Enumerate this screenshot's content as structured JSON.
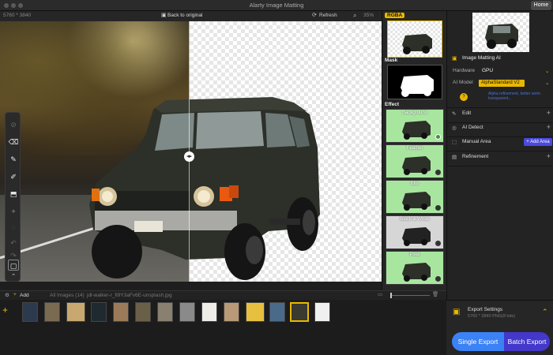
{
  "app": {
    "title": "Alarty Image Matting",
    "home_label": "Home"
  },
  "toolbar": {
    "dimensions": "5760 * 3840",
    "back_label": "Back to original",
    "refresh_label": "Refresh",
    "zoom": "35%"
  },
  "preview_column": {
    "rgba_label": "RGBA",
    "mask_label": "Mask",
    "effect_label": "Effect",
    "effects": [
      {
        "label": "Background",
        "selected": true
      },
      {
        "label": "Feather",
        "selected": false
      },
      {
        "label": "Blur",
        "selected": false
      },
      {
        "label": "Black & White",
        "selected": false
      },
      {
        "label": "Pixel",
        "selected": false
      }
    ]
  },
  "panel": {
    "section_title": "Image Matting AI",
    "hardware_label": "Hardware",
    "hardware_value": "GPU",
    "model_label": "AI Model",
    "model_value": "AlphaStandard  V2",
    "model_hint": "Alpha refinement, better semi-transparent...",
    "edit_label": "Edit",
    "detect_label": "AI Detect",
    "manual_label": "Manual Area",
    "add_area_label": "+ Add Area",
    "refinement_label": "Refinement"
  },
  "strip": {
    "add_label": "Add",
    "all_images_label": "All Images (14)",
    "current_file": "jdl-walker-r_fi9Y3aFv6E-unsplash.jpg",
    "image_count": 14
  },
  "export": {
    "title": "Export Settings",
    "detail": "5760 * 3840  PNG(8 bits)",
    "single_label": "Single Export",
    "batch_label": "Batch Export"
  },
  "colors": {
    "accent": "#e8b800",
    "primary": "#3b82f6",
    "batch": "#4338ca",
    "effect_bg": "#a8e6a0"
  },
  "icons": [
    "search-icon",
    "refresh-icon",
    "back-icon",
    "eraser-icon",
    "brush-icon",
    "picker-icon",
    "gear-icon",
    "plus-icon",
    "chevron-icon"
  ]
}
